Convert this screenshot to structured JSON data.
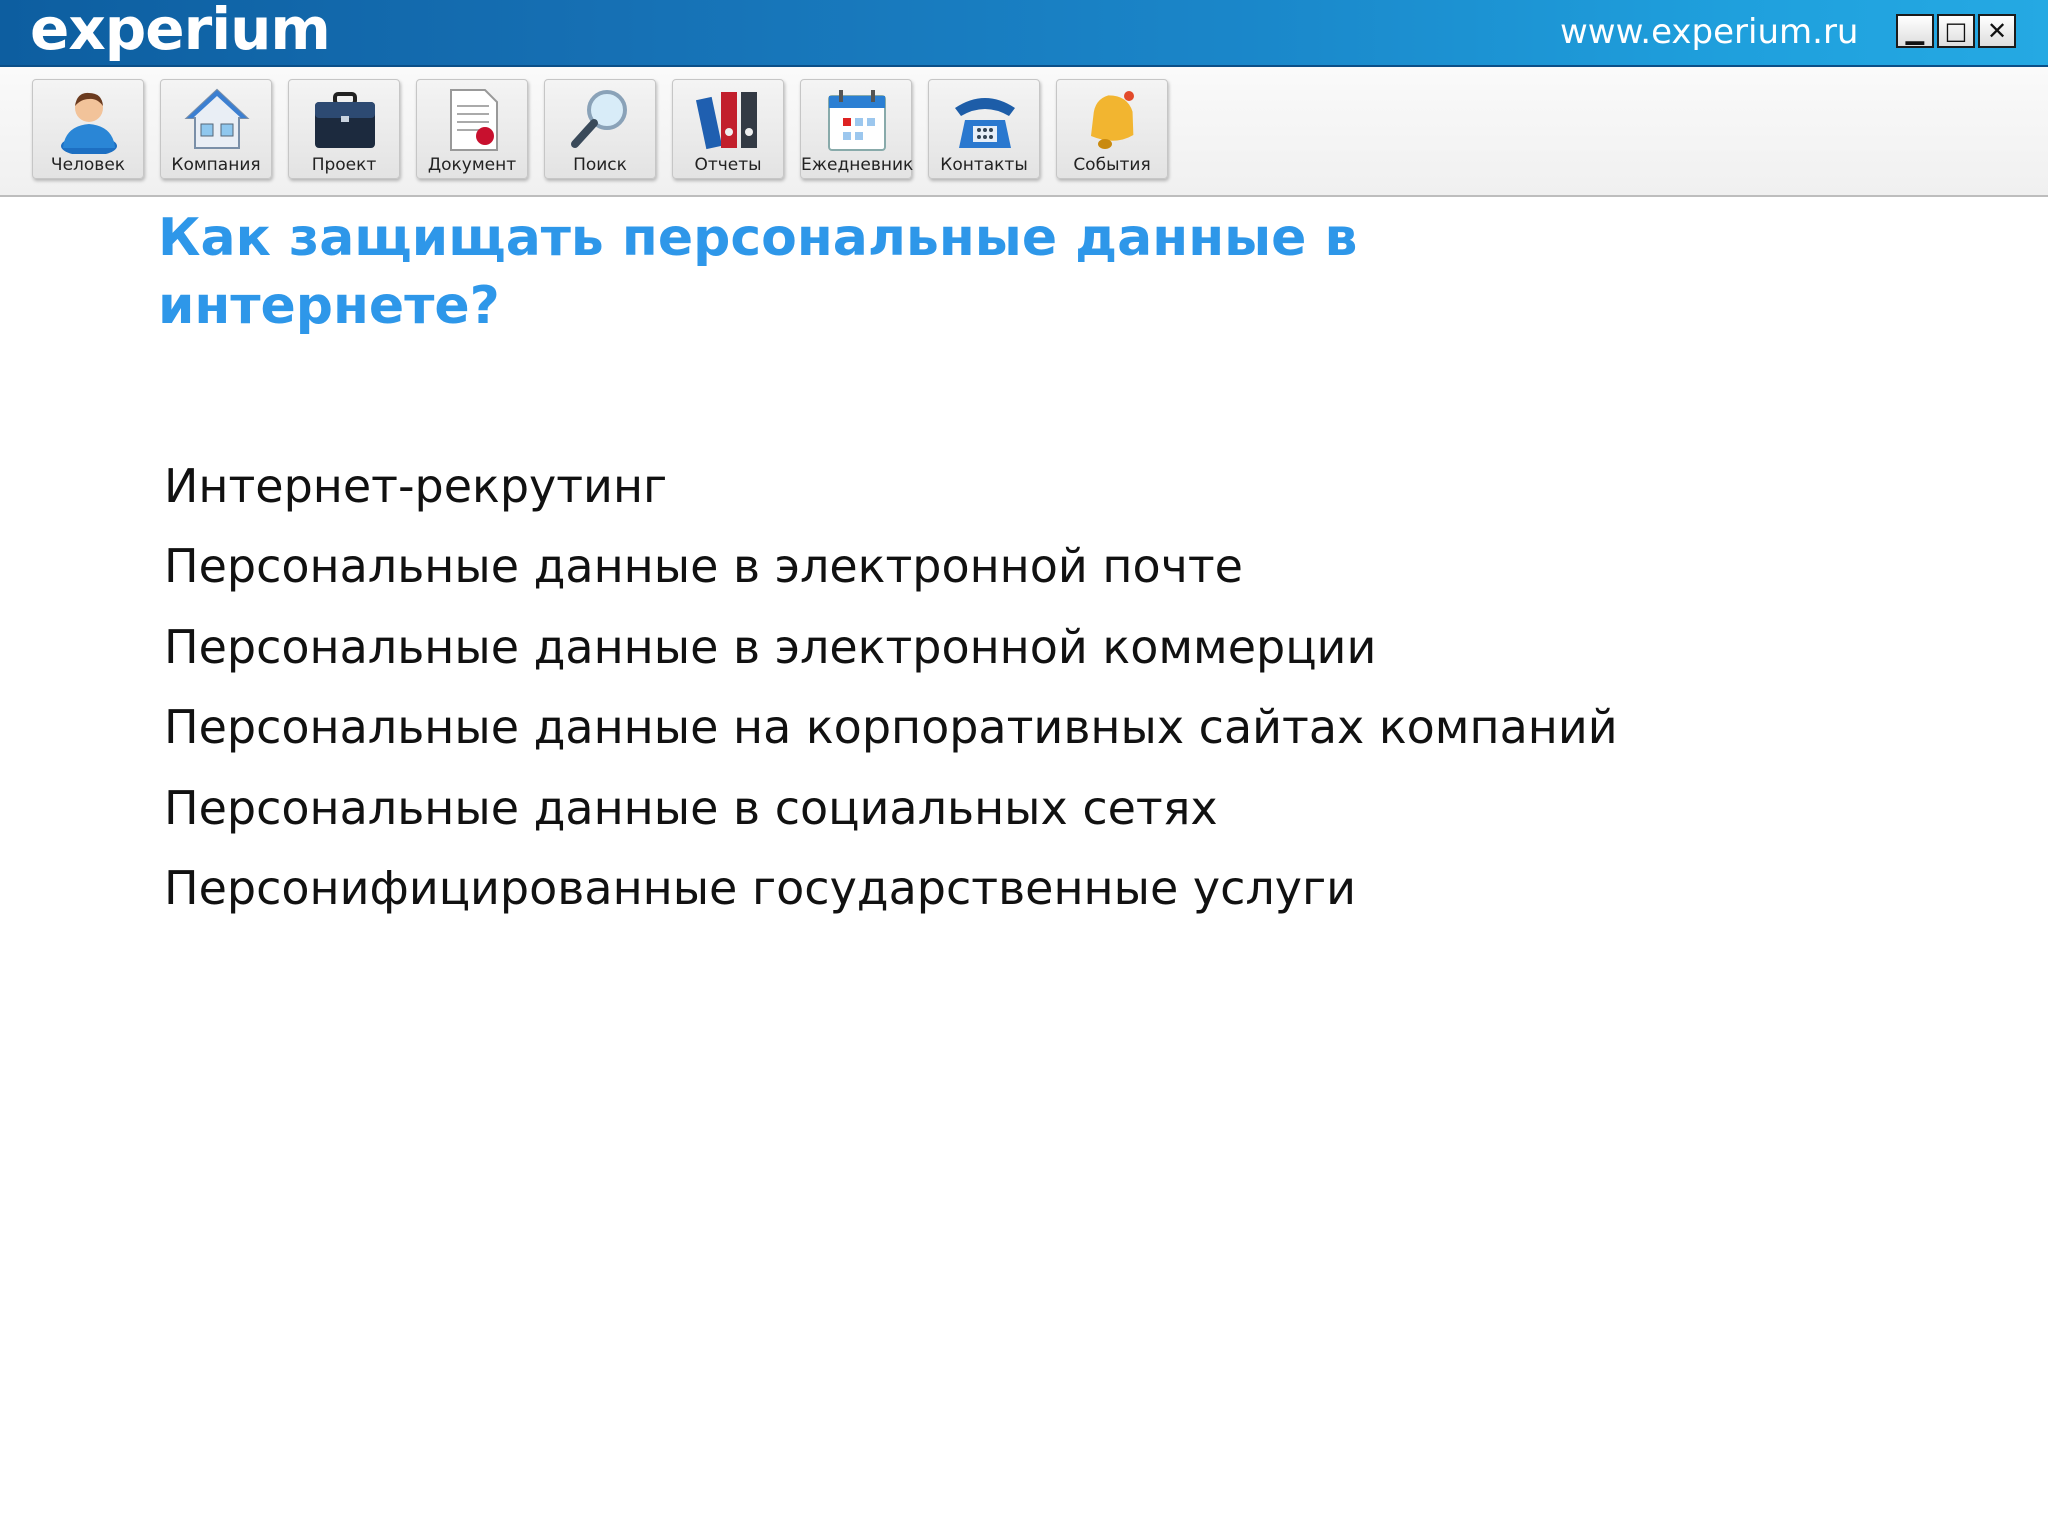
{
  "titlebar": {
    "logo": "experium",
    "url": "www.experium.ru",
    "buttons": [
      {
        "name": "minimize",
        "glyph": "▁"
      },
      {
        "name": "maximize",
        "glyph": "□"
      },
      {
        "name": "close",
        "glyph": "✕"
      }
    ],
    "gradient_colors": [
      "#0d5ea0",
      "#25a9e3"
    ]
  },
  "toolbar": {
    "items": [
      {
        "label": "Человек",
        "icon": "person-icon"
      },
      {
        "label": "Компания",
        "icon": "house-icon"
      },
      {
        "label": "Проект",
        "icon": "briefcase-icon"
      },
      {
        "label": "Документ",
        "icon": "document-icon"
      },
      {
        "label": "Поиск",
        "icon": "magnifier-icon"
      },
      {
        "label": "Отчеты",
        "icon": "binders-icon"
      },
      {
        "label": "Ежедневник",
        "icon": "calendar-icon"
      },
      {
        "label": "Контакты",
        "icon": "telephone-icon"
      },
      {
        "label": "События",
        "icon": "bell-icon"
      }
    ]
  },
  "main": {
    "title": "Как защищать персональные данные в интернете?",
    "title_color": "#2e97e9",
    "topics": [
      "Интернет-рекрутинг",
      "Персональные данные в электронной почте",
      "Персональные данные в электронной коммерции",
      "Персональные данные на корпоративных сайтах компаний",
      "Персональные данные в социальных сетях",
      "Персонифицированные государственные услуги"
    ]
  }
}
